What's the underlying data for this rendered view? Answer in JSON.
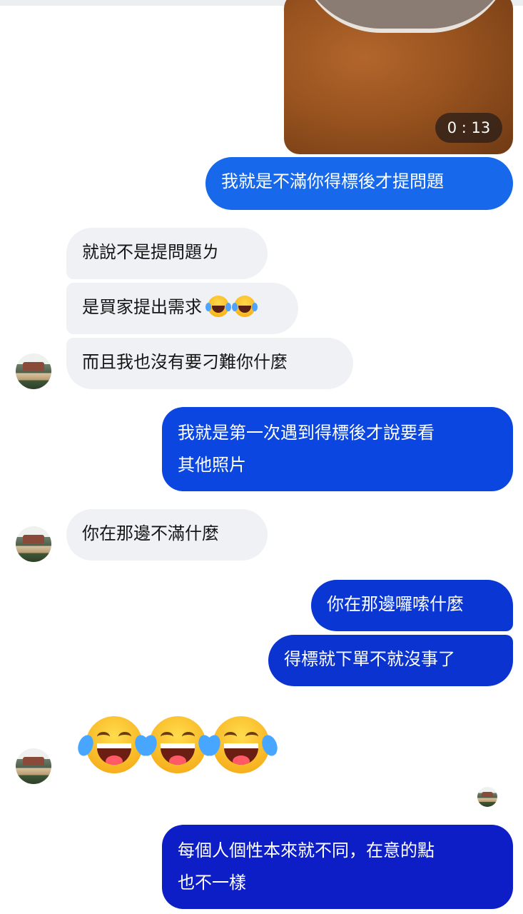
{
  "video": {
    "duration": "0 : 13"
  },
  "messages": [
    {
      "text": "我就是不滿你得標後才提問題",
      "from": "me",
      "color": "#1768ea"
    },
    {
      "text": "就說不是提問題ㄌ",
      "from": "other"
    },
    {
      "text": "是買家提出需求",
      "from": "other",
      "emoji_after": "face-with-tears-of-joy-icon x2"
    },
    {
      "text": "而且我也沒有要刁難你什麼",
      "from": "other"
    },
    {
      "text": "我就是第一次遇到得標後才說要看",
      "text_line2": "其他照片",
      "from": "me",
      "color": "#0b46e0"
    },
    {
      "text": "你在那邊不滿什麼",
      "from": "other"
    },
    {
      "text": "你在那邊囉嗦什麼",
      "from": "me",
      "color": "#0a36d4"
    },
    {
      "text": "得標就下單不就沒事了",
      "from": "me",
      "color": "#0a33cf"
    },
    {
      "text": "每個人個性本來就不同，在意的點",
      "text_line2": "也不一樣",
      "from": "me",
      "color": "#0d1ec6"
    }
  ],
  "reaction": {
    "emoji": "face-with-tears-of-joy-icon",
    "count": 3
  },
  "avatars": {
    "icon": "avatar-house-photo-icon"
  }
}
